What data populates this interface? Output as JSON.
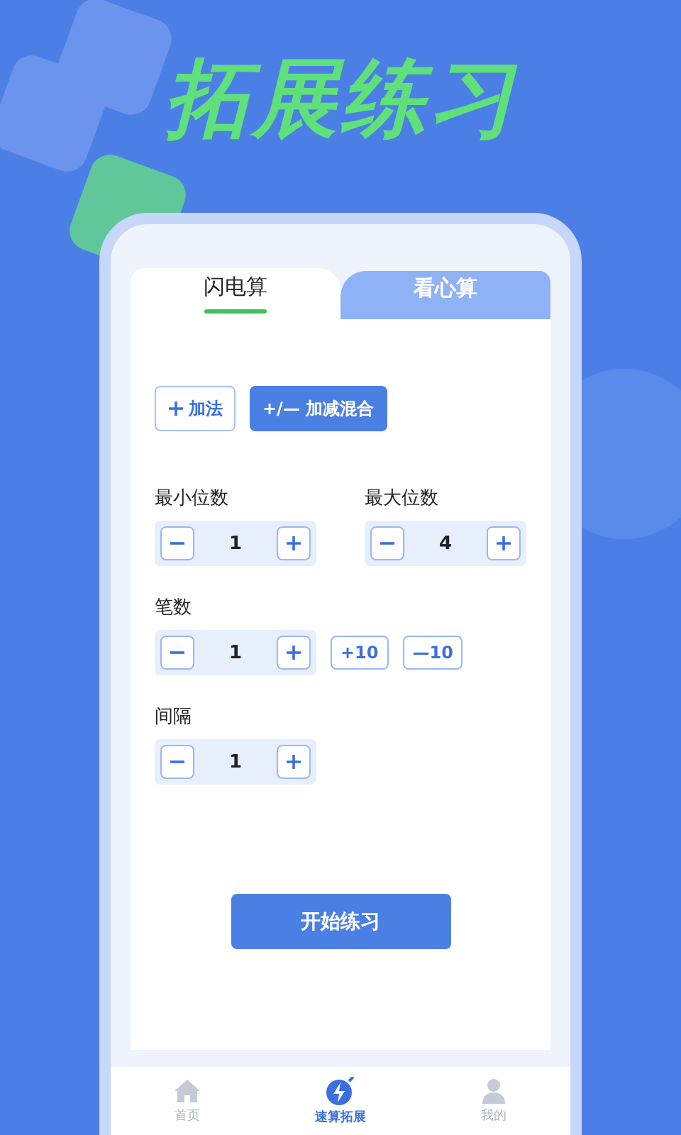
{
  "headline": "拓展练习",
  "tabs": [
    {
      "label": "闪电算",
      "selected": true
    },
    {
      "label": "看心算",
      "selected": false
    }
  ],
  "modes": [
    {
      "label": "加法",
      "kind": "plus",
      "selected": false
    },
    {
      "label": "+/— 加减混合",
      "kind": "text",
      "selected": true
    }
  ],
  "steppers": [
    {
      "label": "最小位数",
      "value": "1"
    },
    {
      "label": "最大位数",
      "value": "4"
    },
    {
      "label": "笔数",
      "value": "1",
      "extras": [
        "+10",
        "—10"
      ]
    },
    {
      "label": "间隔",
      "value": "1"
    }
  ],
  "start_button": "开始练习",
  "nav": [
    {
      "label": "首页",
      "kind": "home",
      "selected": false
    },
    {
      "label": "速算拓展",
      "kind": "bolt",
      "selected": true
    },
    {
      "label": "我的",
      "kind": "user",
      "selected": false
    }
  ]
}
